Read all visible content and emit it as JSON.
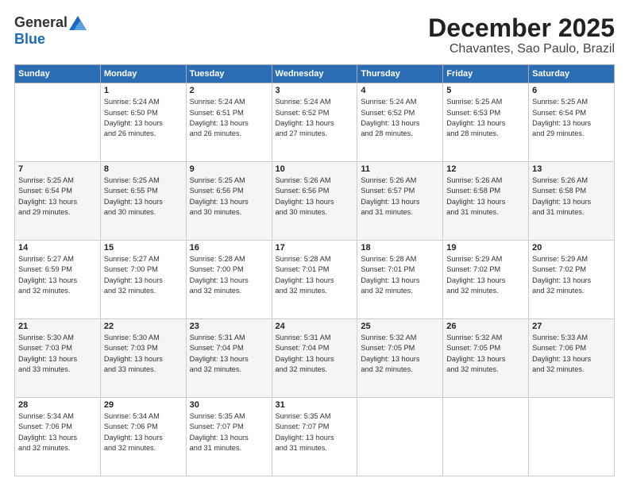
{
  "logo": {
    "general": "General",
    "blue": "Blue"
  },
  "header": {
    "month": "December 2025",
    "location": "Chavantes, Sao Paulo, Brazil"
  },
  "days_of_week": [
    "Sunday",
    "Monday",
    "Tuesday",
    "Wednesday",
    "Thursday",
    "Friday",
    "Saturday"
  ],
  "weeks": [
    [
      {
        "day": "",
        "info": ""
      },
      {
        "day": "1",
        "info": "Sunrise: 5:24 AM\nSunset: 6:50 PM\nDaylight: 13 hours\nand 26 minutes."
      },
      {
        "day": "2",
        "info": "Sunrise: 5:24 AM\nSunset: 6:51 PM\nDaylight: 13 hours\nand 26 minutes."
      },
      {
        "day": "3",
        "info": "Sunrise: 5:24 AM\nSunset: 6:52 PM\nDaylight: 13 hours\nand 27 minutes."
      },
      {
        "day": "4",
        "info": "Sunrise: 5:24 AM\nSunset: 6:52 PM\nDaylight: 13 hours\nand 28 minutes."
      },
      {
        "day": "5",
        "info": "Sunrise: 5:25 AM\nSunset: 6:53 PM\nDaylight: 13 hours\nand 28 minutes."
      },
      {
        "day": "6",
        "info": "Sunrise: 5:25 AM\nSunset: 6:54 PM\nDaylight: 13 hours\nand 29 minutes."
      }
    ],
    [
      {
        "day": "7",
        "info": "Sunrise: 5:25 AM\nSunset: 6:54 PM\nDaylight: 13 hours\nand 29 minutes."
      },
      {
        "day": "8",
        "info": "Sunrise: 5:25 AM\nSunset: 6:55 PM\nDaylight: 13 hours\nand 30 minutes."
      },
      {
        "day": "9",
        "info": "Sunrise: 5:25 AM\nSunset: 6:56 PM\nDaylight: 13 hours\nand 30 minutes."
      },
      {
        "day": "10",
        "info": "Sunrise: 5:26 AM\nSunset: 6:56 PM\nDaylight: 13 hours\nand 30 minutes."
      },
      {
        "day": "11",
        "info": "Sunrise: 5:26 AM\nSunset: 6:57 PM\nDaylight: 13 hours\nand 31 minutes."
      },
      {
        "day": "12",
        "info": "Sunrise: 5:26 AM\nSunset: 6:58 PM\nDaylight: 13 hours\nand 31 minutes."
      },
      {
        "day": "13",
        "info": "Sunrise: 5:26 AM\nSunset: 6:58 PM\nDaylight: 13 hours\nand 31 minutes."
      }
    ],
    [
      {
        "day": "14",
        "info": "Sunrise: 5:27 AM\nSunset: 6:59 PM\nDaylight: 13 hours\nand 32 minutes."
      },
      {
        "day": "15",
        "info": "Sunrise: 5:27 AM\nSunset: 7:00 PM\nDaylight: 13 hours\nand 32 minutes."
      },
      {
        "day": "16",
        "info": "Sunrise: 5:28 AM\nSunset: 7:00 PM\nDaylight: 13 hours\nand 32 minutes."
      },
      {
        "day": "17",
        "info": "Sunrise: 5:28 AM\nSunset: 7:01 PM\nDaylight: 13 hours\nand 32 minutes."
      },
      {
        "day": "18",
        "info": "Sunrise: 5:28 AM\nSunset: 7:01 PM\nDaylight: 13 hours\nand 32 minutes."
      },
      {
        "day": "19",
        "info": "Sunrise: 5:29 AM\nSunset: 7:02 PM\nDaylight: 13 hours\nand 32 minutes."
      },
      {
        "day": "20",
        "info": "Sunrise: 5:29 AM\nSunset: 7:02 PM\nDaylight: 13 hours\nand 32 minutes."
      }
    ],
    [
      {
        "day": "21",
        "info": "Sunrise: 5:30 AM\nSunset: 7:03 PM\nDaylight: 13 hours\nand 33 minutes."
      },
      {
        "day": "22",
        "info": "Sunrise: 5:30 AM\nSunset: 7:03 PM\nDaylight: 13 hours\nand 33 minutes."
      },
      {
        "day": "23",
        "info": "Sunrise: 5:31 AM\nSunset: 7:04 PM\nDaylight: 13 hours\nand 32 minutes."
      },
      {
        "day": "24",
        "info": "Sunrise: 5:31 AM\nSunset: 7:04 PM\nDaylight: 13 hours\nand 32 minutes."
      },
      {
        "day": "25",
        "info": "Sunrise: 5:32 AM\nSunset: 7:05 PM\nDaylight: 13 hours\nand 32 minutes."
      },
      {
        "day": "26",
        "info": "Sunrise: 5:32 AM\nSunset: 7:05 PM\nDaylight: 13 hours\nand 32 minutes."
      },
      {
        "day": "27",
        "info": "Sunrise: 5:33 AM\nSunset: 7:06 PM\nDaylight: 13 hours\nand 32 minutes."
      }
    ],
    [
      {
        "day": "28",
        "info": "Sunrise: 5:34 AM\nSunset: 7:06 PM\nDaylight: 13 hours\nand 32 minutes."
      },
      {
        "day": "29",
        "info": "Sunrise: 5:34 AM\nSunset: 7:06 PM\nDaylight: 13 hours\nand 32 minutes."
      },
      {
        "day": "30",
        "info": "Sunrise: 5:35 AM\nSunset: 7:07 PM\nDaylight: 13 hours\nand 31 minutes."
      },
      {
        "day": "31",
        "info": "Sunrise: 5:35 AM\nSunset: 7:07 PM\nDaylight: 13 hours\nand 31 minutes."
      },
      {
        "day": "",
        "info": ""
      },
      {
        "day": "",
        "info": ""
      },
      {
        "day": "",
        "info": ""
      }
    ]
  ]
}
